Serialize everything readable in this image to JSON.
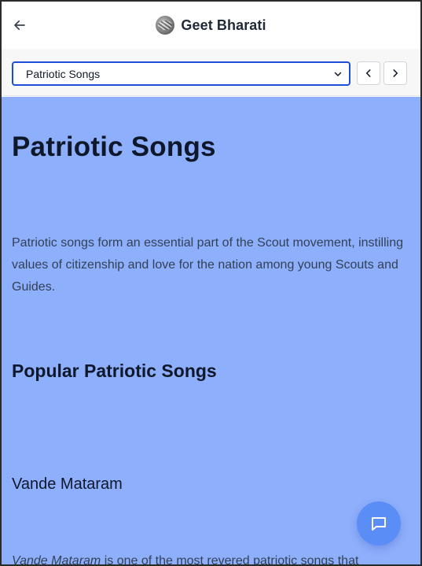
{
  "header": {
    "back_icon": "arrow-left-icon",
    "logo_icon": "app-logo",
    "title": "Geet Bharati"
  },
  "toolbar": {
    "category_select": {
      "selected": "Patriotic Songs",
      "caret_icon": "chevron-down-icon"
    },
    "prev_icon": "chevron-left-icon",
    "next_icon": "chevron-right-icon"
  },
  "content": {
    "background_color": "#8eaffb",
    "title": "Patriotic Songs",
    "intro": "Patriotic songs form an essential part of the Scout movement, instilling values of citizenship and love for the nation among young Scouts and Guides.",
    "section_title": "Popular Patriotic Songs",
    "song": {
      "title": "Vande Mataram",
      "desc_name": "Vande Mataram",
      "desc_rest": " is one of the most revered patriotic songs that"
    }
  },
  "chat": {
    "icon": "chat-bubble-icon",
    "color": "#5b8df7"
  }
}
